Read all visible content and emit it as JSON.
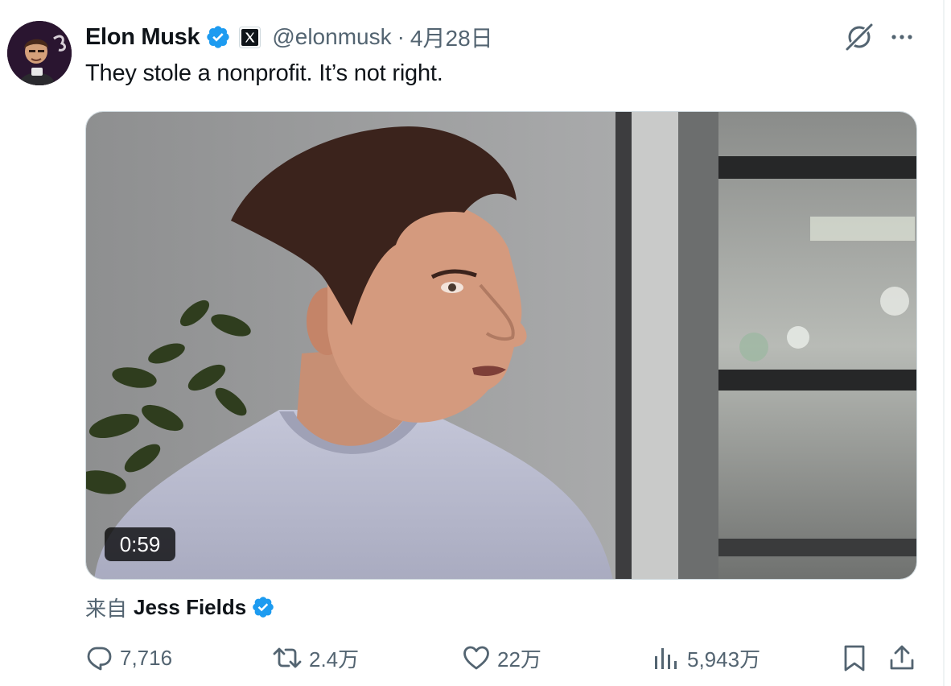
{
  "tweet": {
    "author_name": "Elon Musk",
    "handle": "@elonmusk",
    "separator": "·",
    "date": "4月28日",
    "text": "They stole a nonprofit. It’s not right.",
    "verified_color": "#1d9bf0"
  },
  "media": {
    "duration": "0:59"
  },
  "attribution": {
    "prefix": "来自",
    "name": "Jess Fields"
  },
  "actions": {
    "reply_count": "7,716",
    "retweet_count": "2.4万",
    "like_count": "22万",
    "view_count": "5,943万"
  },
  "icons": {
    "verified": "verified-badge-icon",
    "x_affiliation": "x-logo-icon",
    "grok": "grok-icon",
    "more": "more-icon",
    "reply": "reply-icon",
    "retweet": "retweet-icon",
    "like": "like-icon",
    "views": "views-icon",
    "bookmark": "bookmark-icon",
    "share": "share-icon"
  },
  "colors": {
    "text_primary": "#0f1419",
    "text_secondary": "#536471",
    "accent": "#1d9bf0"
  }
}
